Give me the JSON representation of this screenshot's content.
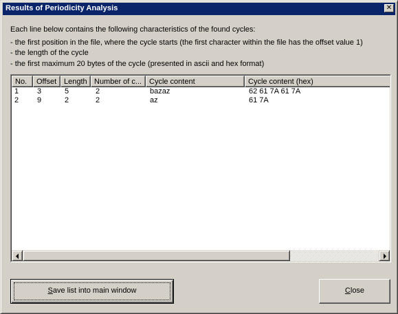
{
  "window": {
    "title": "Results of Periodicity Analysis",
    "close_glyph": "✕"
  },
  "description": {
    "intro": "Each line below contains the following characteristics of the found cycles:",
    "items": [
      "- the first position in the file, where the cycle starts (the first character within the file has the offset value 1)",
      "- the length of the cycle",
      "- the first maximum 20 bytes of the cycle (presented in ascii and hex format)"
    ]
  },
  "list": {
    "columns": [
      "No.",
      "Offset",
      "Length",
      "Number of c...",
      "Cycle content",
      "Cycle content (hex)"
    ],
    "rows": [
      [
        "1",
        "3",
        "5",
        "2",
        "bazaz",
        "62 61 7A 61 7A"
      ],
      [
        "2",
        "9",
        "2",
        "2",
        "az",
        "61 7A"
      ]
    ]
  },
  "buttons": {
    "save_prefix": "",
    "save_mnemonic": "S",
    "save_rest": "ave list into main window",
    "close_mnemonic": "C",
    "close_rest": "lose"
  },
  "icons": {
    "scroll_left": "arrow-left-icon",
    "scroll_right": "arrow-right-icon"
  },
  "colors": {
    "titlebar": "#0a246a",
    "face": "#d4d0c8"
  }
}
